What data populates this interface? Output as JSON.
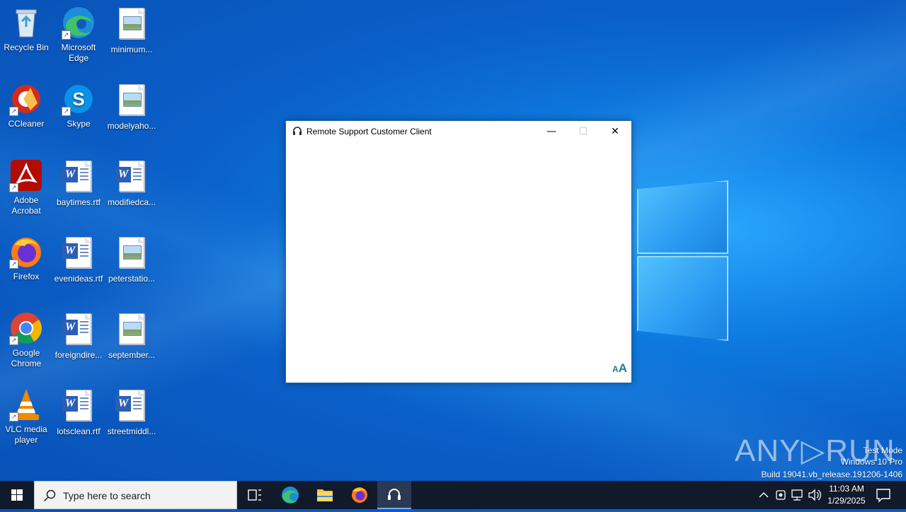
{
  "desktop": {
    "icons": [
      {
        "label": "Recycle Bin"
      },
      {
        "label": "Microsoft Edge"
      },
      {
        "label": "minimum..."
      },
      {
        "label": "CCleaner"
      },
      {
        "label": "Skype"
      },
      {
        "label": "modelyaho..."
      },
      {
        "label": "Adobe Acrobat"
      },
      {
        "label": "baytimes.rtf"
      },
      {
        "label": "modifiedca..."
      },
      {
        "label": "Firefox"
      },
      {
        "label": "evenideas.rtf"
      },
      {
        "label": "peterstatio..."
      },
      {
        "label": "Google Chrome"
      },
      {
        "label": "foreigndire..."
      },
      {
        "label": "september..."
      },
      {
        "label": "VLC media player"
      },
      {
        "label": "lotsclean.rtf"
      },
      {
        "label": "streetmiddl..."
      }
    ]
  },
  "window": {
    "title": "Remote Support Customer Client",
    "minimize": "—",
    "maximize": "☐",
    "close": "✕",
    "font_small": "A",
    "font_big": "A"
  },
  "watermark": {
    "brand": "ANY▷RUN",
    "line1": "Test Mode",
    "line2": "Windows 10 Pro",
    "line3": "Build 19041.vb_release.191206-1406"
  },
  "taskbar": {
    "search_placeholder": "Type here to search",
    "time": "11:03 AM",
    "date": "1/29/2025"
  },
  "colors": {
    "accent": "#0a5fc8",
    "taskbar": "#101a2a",
    "window_border": "#1f5ea8"
  }
}
